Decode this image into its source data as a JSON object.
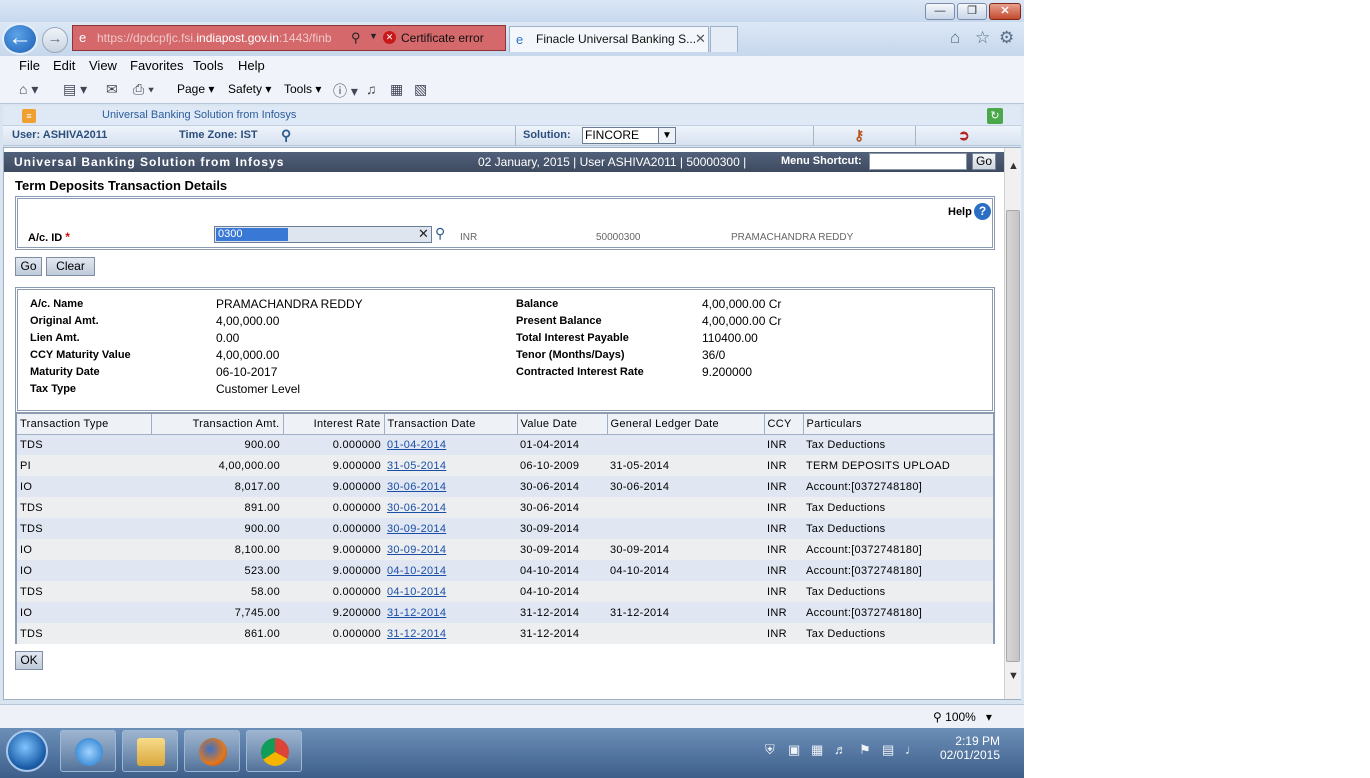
{
  "browser": {
    "address": {
      "url_prefix": "https://dpdcpfjc.fsi.",
      "url_host": "indiapost.gov.in",
      "url_suffix": ":1443/finb",
      "cert_error": "Certificate error"
    },
    "tab_title": "Finacle Universal Banking S...",
    "menu": [
      "File",
      "Edit",
      "View",
      "Favorites",
      "Tools",
      "Help"
    ],
    "commands": {
      "page": "Page",
      "safety": "Safety",
      "tools": "Tools"
    },
    "zoom": "100%"
  },
  "app": {
    "header_title": "Universal Banking Solution from Infosys",
    "user_label": "User: ASHIVA2011",
    "timezone_label": "Time Zone: IST",
    "solution_label": "Solution:",
    "solution_value": "FINCORE",
    "frame_title": "Universal Banking Solution from Infosys",
    "frame_info": "02 January, 2015  |  User  ASHIVA2011  |  50000300  |",
    "menu_shortcut_label": "Menu Shortcut:",
    "go_label": "Go"
  },
  "page": {
    "title": "Term Deposits Transaction Details",
    "help_label": "Help",
    "acid_label": "A/c. ID",
    "required_mark": "*",
    "acid_value": "0300",
    "currency": "INR",
    "sol_id": "50000300",
    "holder_name": "PRAMACHANDRA REDDY",
    "go_button": "Go",
    "clear_button": "Clear",
    "ok_button": "OK"
  },
  "details": {
    "left": [
      {
        "label": "A/c. Name",
        "value": "PRAMACHANDRA REDDY"
      },
      {
        "label": "Original Amt.",
        "value": "4,00,000.00"
      },
      {
        "label": "Lien Amt.",
        "value": "0.00"
      },
      {
        "label": "CCY Maturity Value",
        "value": "4,00,000.00"
      },
      {
        "label": "Maturity Date",
        "value": "06-10-2017"
      },
      {
        "label": "Tax Type",
        "value": "Customer Level"
      }
    ],
    "right": [
      {
        "label": "Balance",
        "value": "4,00,000.00 Cr"
      },
      {
        "label": "Present Balance",
        "value": "4,00,000.00 Cr"
      },
      {
        "label": "Total Interest Payable",
        "value": "110400.00"
      },
      {
        "label": "Tenor (Months/Days)",
        "value": "36/0"
      },
      {
        "label": "Contracted Interest Rate",
        "value": "9.200000"
      }
    ]
  },
  "transactions": {
    "columns": [
      "Transaction Type",
      "Transaction Amt.",
      "Interest Rate",
      "Transaction Date",
      "Value Date",
      "General Ledger Date",
      "CCY",
      "Particulars"
    ],
    "rows": [
      {
        "type": "TDS",
        "amt": "900.00",
        "rate": "0.000000",
        "tdate": "01-04-2014",
        "vdate": "01-04-2014",
        "gl": "",
        "ccy": "INR",
        "part": "Tax Deductions"
      },
      {
        "type": "PI",
        "amt": "4,00,000.00",
        "rate": "9.000000",
        "tdate": "31-05-2014",
        "vdate": "06-10-2009",
        "gl": "31-05-2014",
        "ccy": "INR",
        "part": "TERM DEPOSITS UPLOAD"
      },
      {
        "type": "IO",
        "amt": "8,017.00",
        "rate": "9.000000",
        "tdate": "30-06-2014",
        "vdate": "30-06-2014",
        "gl": "30-06-2014",
        "ccy": "INR",
        "part": "Account:[0372748180]"
      },
      {
        "type": "TDS",
        "amt": "891.00",
        "rate": "0.000000",
        "tdate": "30-06-2014",
        "vdate": "30-06-2014",
        "gl": "",
        "ccy": "INR",
        "part": "Tax Deductions"
      },
      {
        "type": "TDS",
        "amt": "900.00",
        "rate": "0.000000",
        "tdate": "30-09-2014",
        "vdate": "30-09-2014",
        "gl": "",
        "ccy": "INR",
        "part": "Tax Deductions"
      },
      {
        "type": "IO",
        "amt": "8,100.00",
        "rate": "9.000000",
        "tdate": "30-09-2014",
        "vdate": "30-09-2014",
        "gl": "30-09-2014",
        "ccy": "INR",
        "part": "Account:[0372748180]"
      },
      {
        "type": "IO",
        "amt": "523.00",
        "rate": "9.000000",
        "tdate": "04-10-2014",
        "vdate": "04-10-2014",
        "gl": "04-10-2014",
        "ccy": "INR",
        "part": "Account:[0372748180]"
      },
      {
        "type": "TDS",
        "amt": "58.00",
        "rate": "0.000000",
        "tdate": "04-10-2014",
        "vdate": "04-10-2014",
        "gl": "",
        "ccy": "INR",
        "part": "Tax Deductions"
      },
      {
        "type": "IO",
        "amt": "7,745.00",
        "rate": "9.200000",
        "tdate": "31-12-2014",
        "vdate": "31-12-2014",
        "gl": "31-12-2014",
        "ccy": "INR",
        "part": "Account:[0372748180]"
      },
      {
        "type": "TDS",
        "amt": "861.00",
        "rate": "0.000000",
        "tdate": "31-12-2014",
        "vdate": "31-12-2014",
        "gl": "",
        "ccy": "INR",
        "part": "Tax Deductions"
      }
    ]
  },
  "taskbar": {
    "time": "2:19 PM",
    "date": "02/01/2015"
  }
}
